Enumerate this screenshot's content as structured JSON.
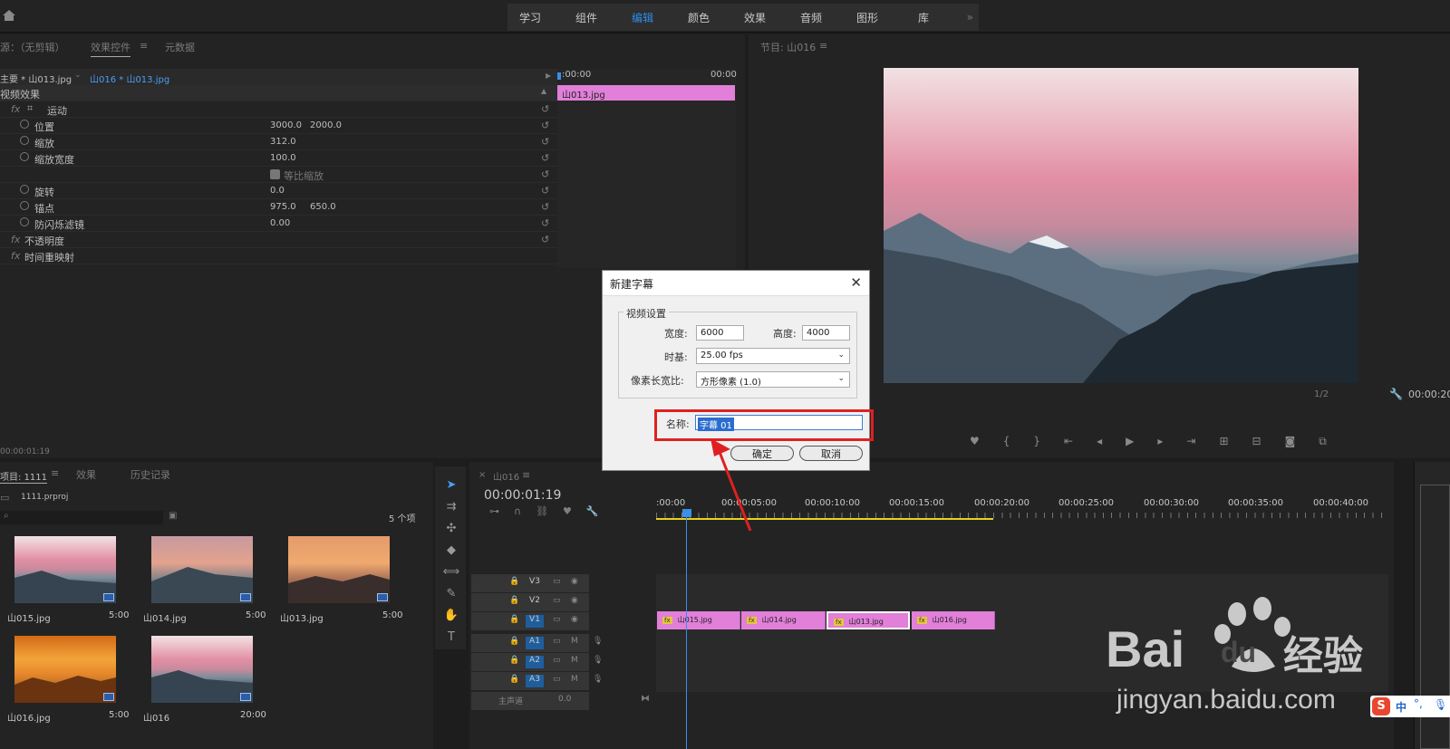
{
  "workspaces": [
    "学习",
    "组件",
    "编辑",
    "颜色",
    "效果",
    "音频",
    "图形",
    "库"
  ],
  "workspace_active": "编辑",
  "left_panel": {
    "tab_source": "源：（无剪辑）",
    "tab_effect_controls": "效果控件",
    "tab_metadata": "元数据",
    "master_clip": "主要 * 山013.jpg",
    "seq_clip": "山016 * 山013.jpg",
    "mini_time_start": ":00:00",
    "mini_time_end": "00:00",
    "mini_clip": "山013.jpg",
    "section_video_effects": "视频效果",
    "motion": "运动",
    "position_label": "位置",
    "position_x": "3000.0",
    "position_y": "2000.0",
    "scale_label": "缩放",
    "scale_value": "312.0",
    "scale_width_label": "缩放宽度",
    "scale_width_value": "100.0",
    "uniform_scale": "等比缩放",
    "rotation_label": "旋转",
    "rotation_value": "0.0",
    "anchor_label": "锚点",
    "anchor_x": "975.0",
    "anchor_y": "650.0",
    "flicker_label": "防闪烁滤镜",
    "flicker_value": "0.00",
    "opacity_label": "不透明度",
    "time_remap_label": "时间重映射",
    "timecode": "00:00:01:19"
  },
  "program_monitor": {
    "title": "节目: 山016",
    "zoom": "1/2",
    "timecode": "00:00:20"
  },
  "project_panel": {
    "tab_project": "项目: 1111",
    "tab_effects": "效果",
    "tab_history": "历史记录",
    "project_file": "1111.prproj",
    "item_count": "5 个项",
    "items": [
      {
        "name": "山015.jpg",
        "duration": "5:00"
      },
      {
        "name": "山014.jpg",
        "duration": "5:00"
      },
      {
        "name": "山013.jpg",
        "duration": "5:00"
      },
      {
        "name": "山016.jpg",
        "duration": "5:00"
      },
      {
        "name": "山016",
        "duration": "20:00"
      }
    ]
  },
  "timeline": {
    "sequence_tab": "山016",
    "timecode": "00:00:01:19",
    "ruler": [
      ":00:00",
      "00:00:05:00",
      "00:00:10:00",
      "00:00:15:00",
      "00:00:20:00",
      "00:00:25:00",
      "00:00:30:00",
      "00:00:35:00",
      "00:00:40:00"
    ],
    "tracks": [
      "V3",
      "V2",
      "V1",
      "A1",
      "A2",
      "A3"
    ],
    "master_label": "主声道",
    "master_value": "0.0",
    "clips": [
      "山015.jpg",
      "山014.jpg",
      "山013.jpg",
      "山016.jpg"
    ]
  },
  "dialog": {
    "title": "新建字幕",
    "group_label": "视频设置",
    "width_label": "宽度:",
    "width_value": "6000",
    "height_label": "高度:",
    "height_value": "4000",
    "timebase_label": "时基:",
    "timebase_value": "25.00 fps",
    "par_label": "像素长宽比:",
    "par_value": "方形像素 (1.0)",
    "name_label": "名称:",
    "name_value": "字幕 01",
    "ok_button": "确定",
    "cancel_button": "取消"
  },
  "watermark": {
    "brand": "Bai",
    "brand2": "du",
    "brand_cn": "经验",
    "url": "jingyan.baidu.com"
  },
  "ime": {
    "label": "中"
  },
  "colors": {
    "accent_blue": "#2d8ceb",
    "clip_pink": "#e17fd9",
    "highlight_red": "#e02020",
    "playhead": "#3a8fe8"
  }
}
